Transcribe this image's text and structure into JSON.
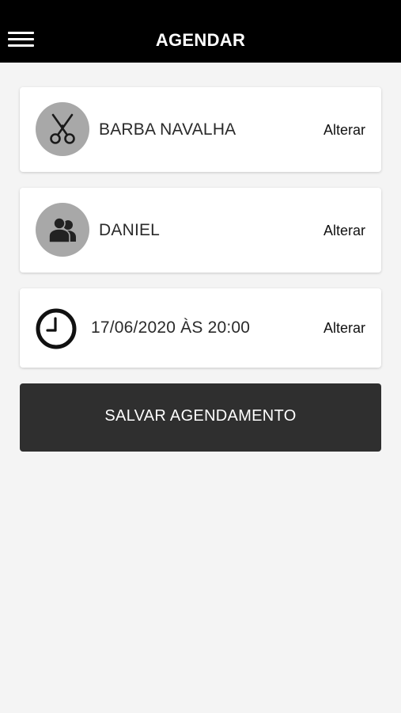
{
  "header": {
    "title": "AGENDAR",
    "menu_icon": "hamburger-menu-icon"
  },
  "cards": [
    {
      "label": "BARBA NAVALHA",
      "action": "Alterar",
      "icon": "scissors-icon"
    },
    {
      "label": "DANIEL",
      "action": "Alterar",
      "icon": "users-icon"
    },
    {
      "label": "17/06/2020 ÀS 20:00",
      "action": "Alterar",
      "icon": "clock-icon"
    }
  ],
  "save_button": {
    "label": "SALVAR AGENDAMENTO"
  },
  "colors": {
    "header_bg": "#000000",
    "page_bg": "#f4f4f4",
    "avatar_bg": "#a8a8a8",
    "button_bg": "#2f2f2f"
  }
}
